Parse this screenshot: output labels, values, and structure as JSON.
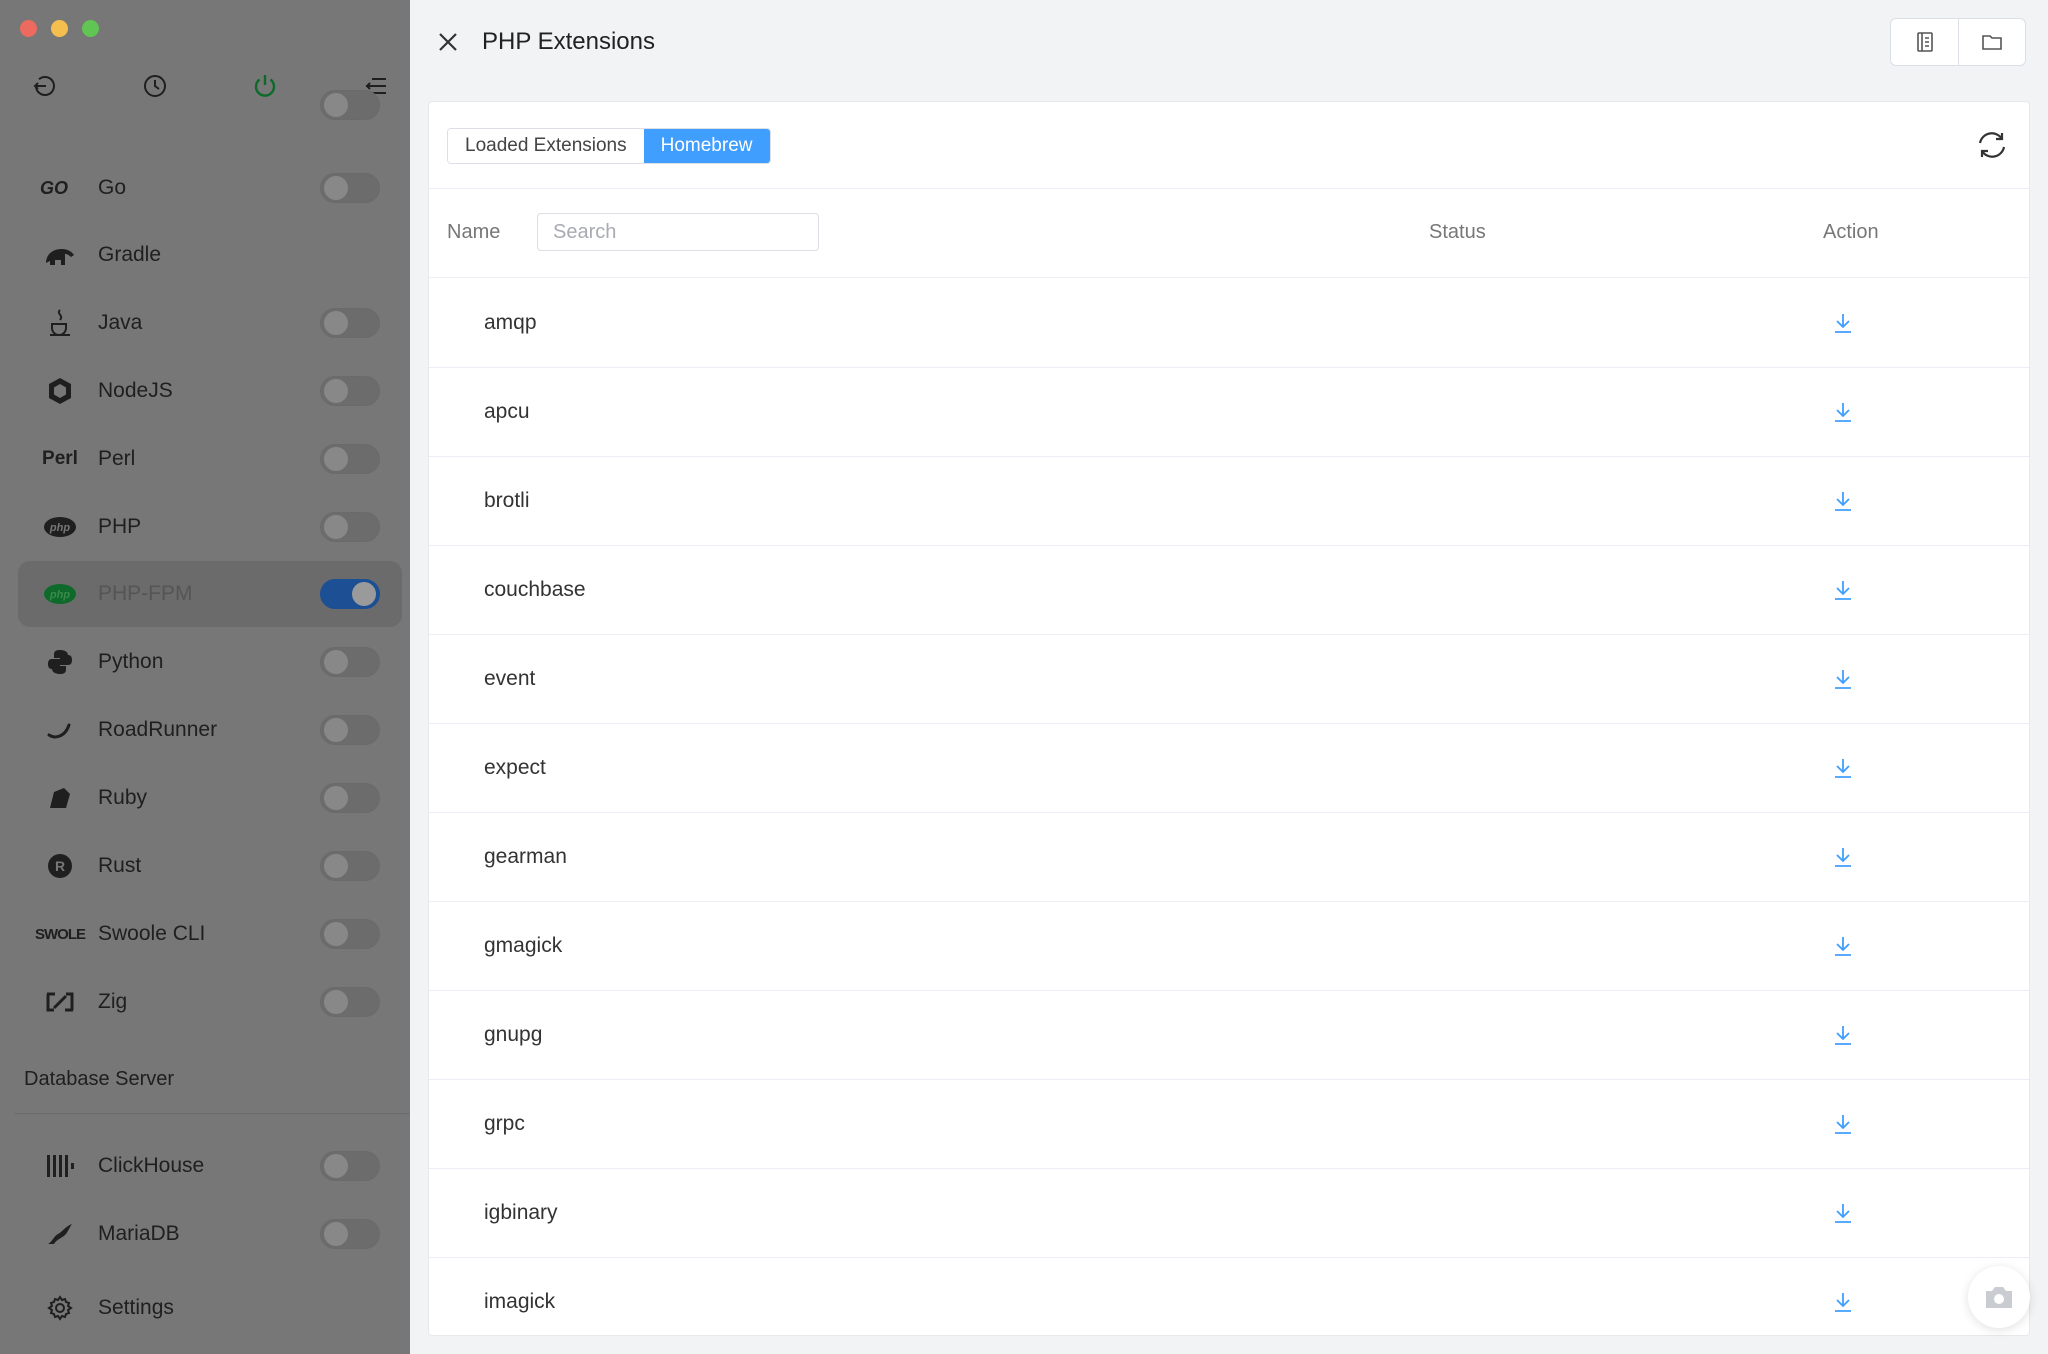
{
  "window": {
    "title": "PHP Extensions"
  },
  "sidebar": {
    "section_database": "Database Server",
    "items": [
      {
        "label": "Go",
        "icon": "go-icon",
        "enabled": false,
        "active": false
      },
      {
        "label": "Gradle",
        "icon": "gradle-elephant-icon",
        "enabled": null,
        "active": false
      },
      {
        "label": "Java",
        "icon": "java-cup-icon",
        "enabled": false,
        "active": false
      },
      {
        "label": "NodeJS",
        "icon": "nodejs-hexagon-icon",
        "enabled": false,
        "active": false
      },
      {
        "label": "Perl",
        "icon": "perl-icon",
        "enabled": false,
        "active": false
      },
      {
        "label": "PHP",
        "icon": "php-icon",
        "enabled": false,
        "active": false
      },
      {
        "label": "PHP-FPM",
        "icon": "php-icon",
        "enabled": true,
        "active": true
      },
      {
        "label": "Python",
        "icon": "python-icon",
        "enabled": false,
        "active": false
      },
      {
        "label": "RoadRunner",
        "icon": "roadrunner-icon",
        "enabled": false,
        "active": false
      },
      {
        "label": "Ruby",
        "icon": "ruby-icon",
        "enabled": false,
        "active": false
      },
      {
        "label": "Rust",
        "icon": "rust-icon",
        "enabled": false,
        "active": false
      },
      {
        "label": "Swoole CLI",
        "icon": "swoole-icon",
        "enabled": false,
        "active": false
      },
      {
        "label": "Zig",
        "icon": "zig-icon",
        "enabled": false,
        "active": false
      }
    ],
    "db_items": [
      {
        "label": "ClickHouse",
        "icon": "clickhouse-icon",
        "enabled": false
      },
      {
        "label": "MariaDB",
        "icon": "mariadb-seal-icon",
        "enabled": false
      }
    ],
    "settings_label": "Settings",
    "top_icons": [
      "logout-icon",
      "history-clock-icon",
      "power-icon",
      "menu-collapse-icon"
    ]
  },
  "drawer": {
    "title": "PHP Extensions",
    "tabs": [
      {
        "label": "Loaded Extensions",
        "active": false
      },
      {
        "label": "Homebrew",
        "active": true
      }
    ],
    "table": {
      "col_name": "Name",
      "col_status": "Status",
      "col_action": "Action",
      "search_placeholder": "Search",
      "rows": [
        {
          "name": "amqp",
          "status": ""
        },
        {
          "name": "apcu",
          "status": ""
        },
        {
          "name": "brotli",
          "status": ""
        },
        {
          "name": "couchbase",
          "status": ""
        },
        {
          "name": "event",
          "status": ""
        },
        {
          "name": "expect",
          "status": ""
        },
        {
          "name": "gearman",
          "status": ""
        },
        {
          "name": "gmagick",
          "status": ""
        },
        {
          "name": "gnupg",
          "status": ""
        },
        {
          "name": "grpc",
          "status": ""
        },
        {
          "name": "igbinary",
          "status": ""
        },
        {
          "name": "imagick",
          "status": ""
        }
      ]
    }
  },
  "colors": {
    "accent": "#409eff",
    "toggle_on": "#1d4f95",
    "power_green": "#2e7d32"
  }
}
